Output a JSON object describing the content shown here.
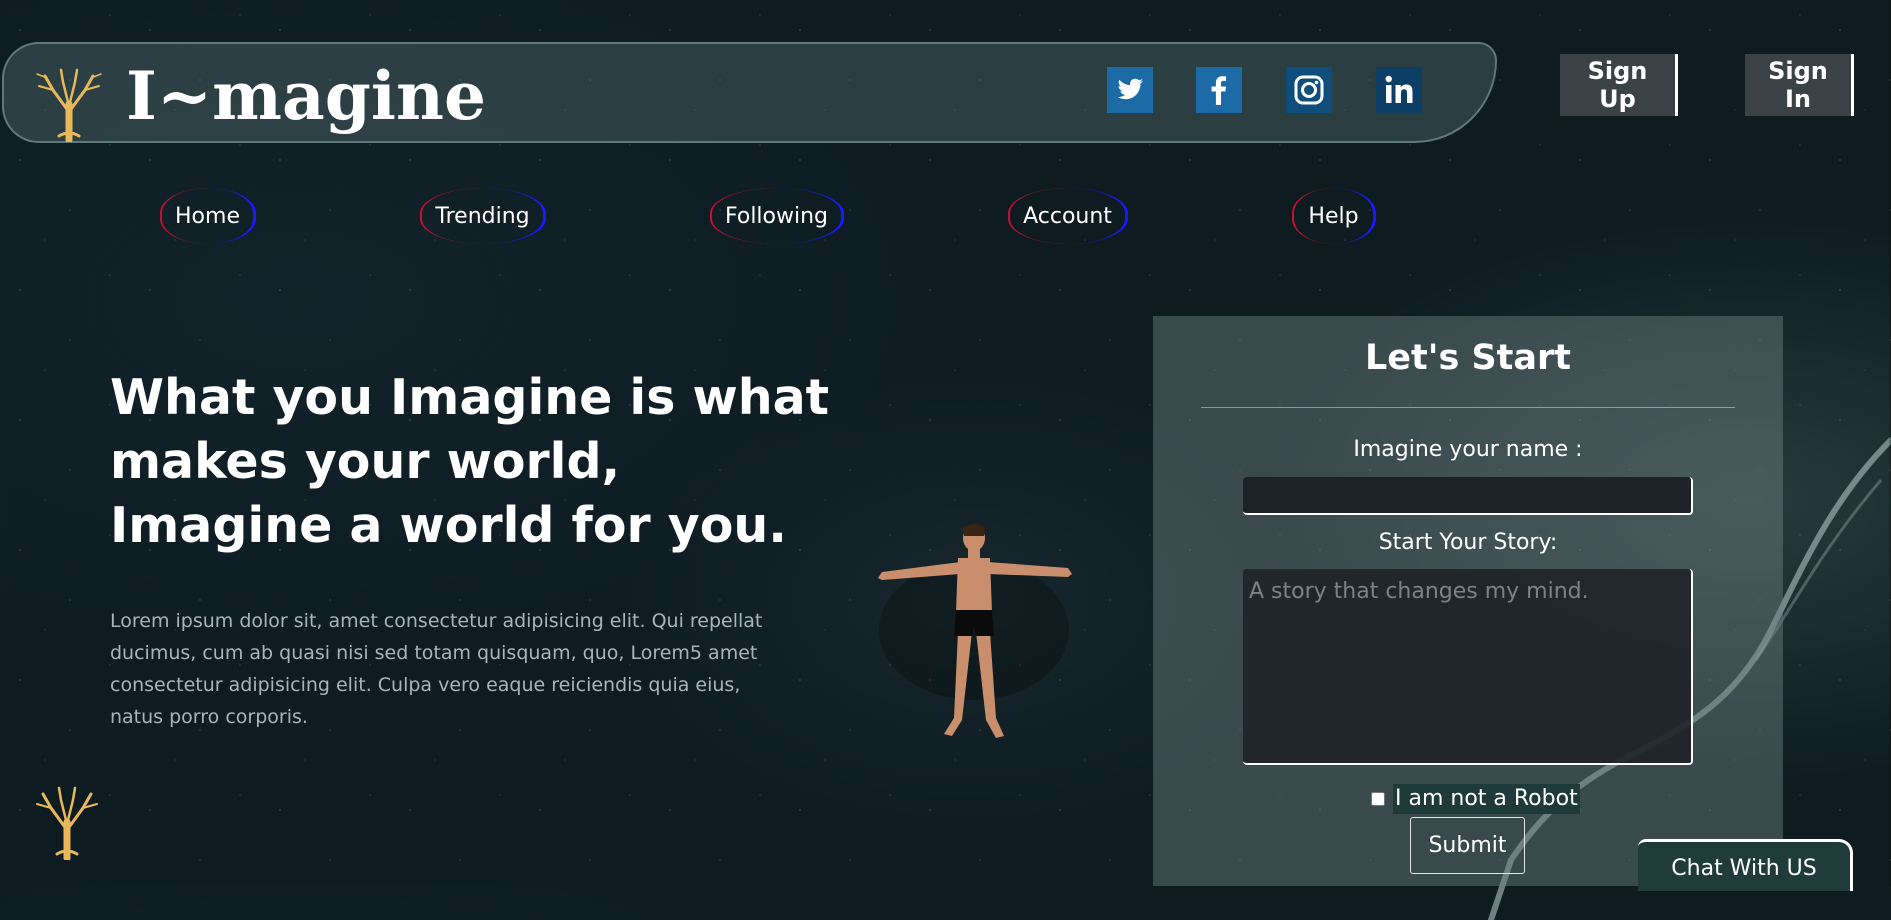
{
  "header": {
    "brand": "I~magine",
    "logo_icon": "tree-logo-icon",
    "social": [
      {
        "name": "twitter",
        "icon": "twitter-icon",
        "color": "#1c6aa6"
      },
      {
        "name": "facebook",
        "icon": "facebook-icon",
        "color": "#1c6aa6"
      },
      {
        "name": "instagram",
        "icon": "instagram-icon",
        "color": "#0d4e7c"
      },
      {
        "name": "linkedin",
        "icon": "linkedin-icon",
        "color": "#0d3f66"
      }
    ],
    "signup_label": "Sign Up",
    "signin_label": "Sign In"
  },
  "nav": {
    "items": [
      {
        "label": "Home"
      },
      {
        "label": "Trending"
      },
      {
        "label": "Following"
      },
      {
        "label": "Account"
      },
      {
        "label": "Help"
      }
    ]
  },
  "hero": {
    "title": "What you Imagine is what makes your world, Imagine a world for you.",
    "text": "Lorem ipsum dolor sit, amet consectetur adipisicing elit. Qui repellat ducimus, cum ab quasi nisi sed totam quisquam, quo, Lorem5 amet consectetur adipisicing elit. Culpa vero eaque reiciendis quia eius, natus porro corporis."
  },
  "form": {
    "title": "Let's Start",
    "name_label": "Imagine your name :",
    "name_value": "",
    "story_label": "Start Your Story:",
    "story_placeholder": "A story that changes my mind.",
    "robot_label": "I am not a Robot",
    "robot_checked": false,
    "submit_label": "Submit"
  },
  "chat": {
    "label": "Chat With US"
  },
  "colors": {
    "background": "#0e1c22",
    "tree_gold": "#e8b95a",
    "nav_left_arc": "#c8102e",
    "nav_right_arc": "#1a1aff"
  }
}
